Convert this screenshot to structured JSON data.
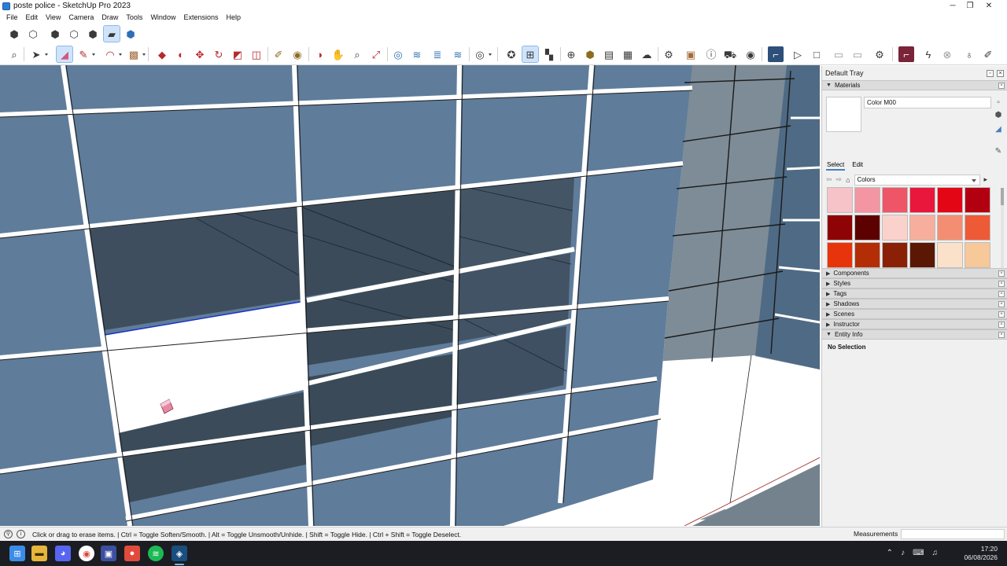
{
  "window": {
    "title": "poste police - SketchUp Pro 2023",
    "controls": [
      "─",
      "❐",
      "✕"
    ]
  },
  "menu": [
    "File",
    "Edit",
    "View",
    "Camera",
    "Draw",
    "Tools",
    "Window",
    "Extensions",
    "Help"
  ],
  "toolbar_views": [
    "iso-view-icon",
    "top-view-icon",
    "front-view-icon",
    "right-view-icon",
    "back-view-icon",
    "left-view-icon",
    "bottom-view-icon"
  ],
  "toolbar_main": [
    "zoom-icon",
    "select-icon",
    "eraser-icon",
    "pencil-icon",
    "arc-icon",
    "shape-icon",
    "push-pull-icon",
    "follow-me-icon",
    "move-icon",
    "rotate-icon",
    "scale-icon",
    "offset-icon",
    "tape-measure-icon",
    "paint-bucket-icon",
    "orbit-icon",
    "text-icon",
    "zoom-extents-icon",
    "section-plane-icon",
    "section-display-icon",
    "section-cut-icon",
    "section-fill-icon",
    "user-icon",
    "components-icon",
    "materials-icon",
    "layers-icon",
    "add-location-icon",
    "terrain-icon",
    "photo-texture-icon",
    "pattern-icon",
    "cloud-icon",
    "settings-icon",
    "3d-warehouse-icon",
    "info-icon",
    "cart-icon",
    "account-icon",
    "scenes-icon",
    "play-icon",
    "stop-icon",
    "camera-icon",
    "video-icon",
    "extension-icon",
    "profile-icon",
    "flash-icon",
    "close-icon",
    "bulb-icon",
    "edit-icon"
  ],
  "tray": {
    "title": "Default Tray",
    "materials": {
      "title": "Materials",
      "name": "Color M00",
      "tabs": [
        "Select",
        "Edit"
      ],
      "library": "Colors",
      "swatches": [
        "#f6c3c8",
        "#f395a2",
        "#ee5567",
        "#e8173b",
        "#e30614",
        "#b30010",
        "#8e0303",
        "#5c0000",
        "#fbd2cb",
        "#f7ae9c",
        "#f38e73",
        "#ee5a36",
        "#e8340a",
        "#b32e06",
        "#8a2106",
        "#5a1704",
        "#fbe1c9",
        "#f7c89a",
        "#f4ae6b",
        "#f09938",
        "#ed7e0d",
        "#b6630d",
        "#8c4a0a",
        "#5a3207"
      ]
    },
    "panels": [
      "Components",
      "Styles",
      "Tags",
      "Shadows",
      "Scenes",
      "Instructor"
    ],
    "entity_info": {
      "title": "Entity Info",
      "value": "No Selection"
    }
  },
  "status": {
    "hint": "Click or drag to erase items. | Ctrl = Toggle Soften/Smooth. | Alt = Toggle Unsmooth/Unhide. | Shift = Toggle Hide. | Ctrl + Shift = Toggle Deselect.",
    "measurements_label": "Measurements"
  },
  "taskbar": {
    "time": "17:20",
    "date": "06/08/2026"
  }
}
